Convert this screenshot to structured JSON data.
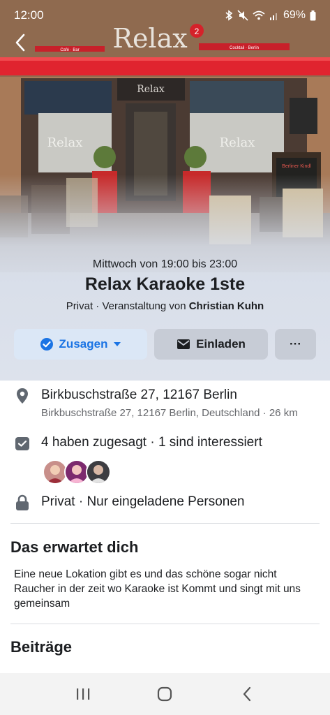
{
  "status_bar": {
    "time": "12:00",
    "battery": "69%",
    "icons": [
      "bluetooth-icon",
      "mute-icon",
      "wifi-icon",
      "signal-icon",
      "battery-icon"
    ]
  },
  "cover": {
    "sign_text": "Relax",
    "sign_badge": "2",
    "sign_left": "Café · Bar",
    "sign_right": "Cocktail · Berlin",
    "door_text": "Relax",
    "window_left_text": "Relax",
    "window_right_text": "Relax",
    "board_text": "Berliner Kindl"
  },
  "event": {
    "date": "Mittwoch von 19:00 bis 23:00",
    "title": "Relax Karaoke 1ste",
    "privacy_prefix": "Privat · Veranstaltung von ",
    "host": "Christian Kuhn"
  },
  "actions": {
    "going_label": "Zusagen",
    "invite_label": "Einladen",
    "more_label": "···"
  },
  "details": {
    "address": "Birkbuschstraße 27, 12167 Berlin",
    "address_full": "Birkbuschstraße 27, 12167 Berlin, Deutschland · 26 km",
    "responses": "4 haben zugesagt · 1 sind interessiert",
    "privacy": "Privat · Nur eingeladene Personen"
  },
  "about": {
    "title": "Das erwartet dich",
    "text": "Eine neue Lokation gibt es und das schöne sogar nicht Raucher in der zeit wo Karaoke ist Kommt und singt mit uns gemeinsam"
  },
  "posts": {
    "title": "Beiträge"
  },
  "colors": {
    "accent": "#1b74e4",
    "awning": "#e0242f",
    "chair": "#cdbb98"
  }
}
